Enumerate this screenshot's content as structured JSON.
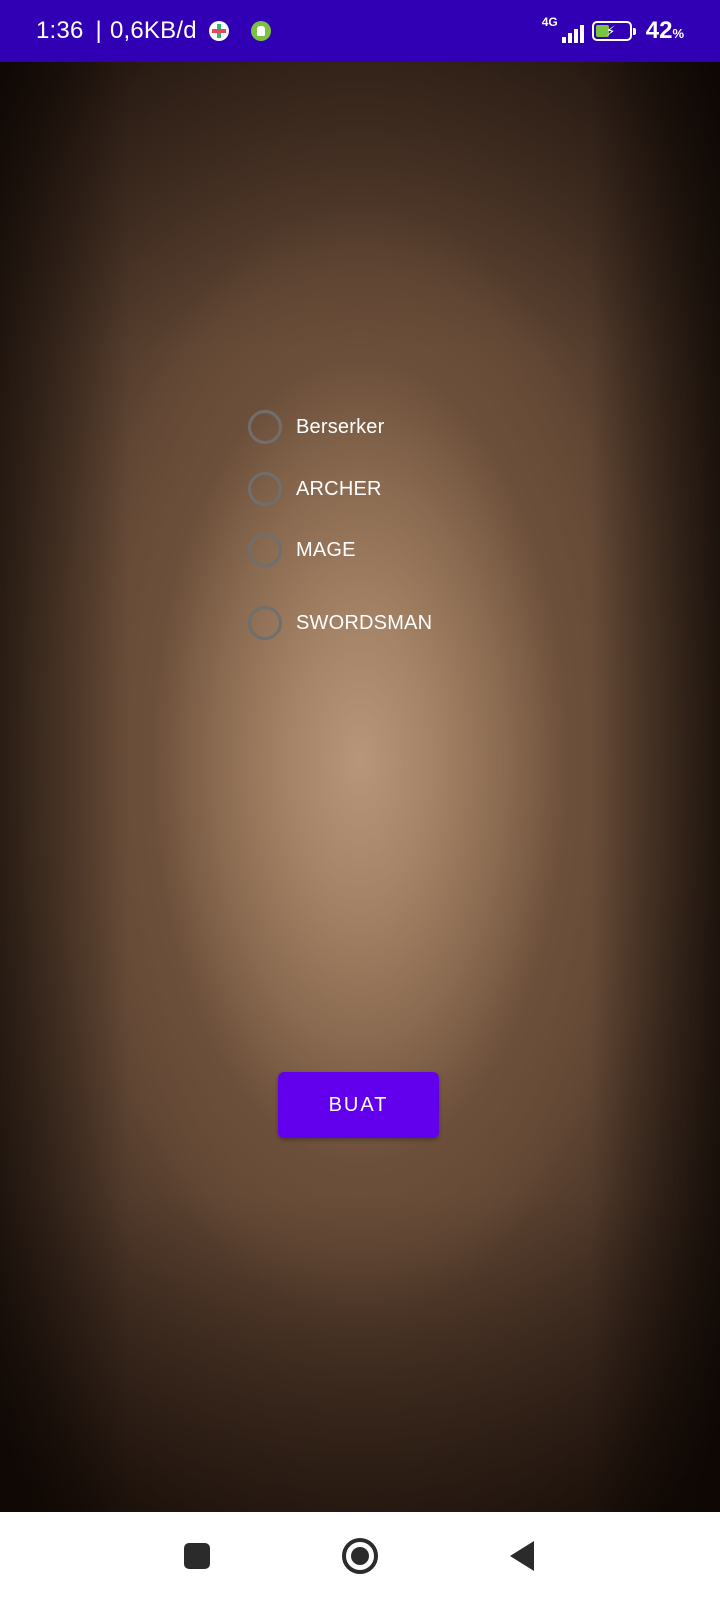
{
  "status_bar": {
    "time": "1:36",
    "separator": "|",
    "data_rate": "0,6KB/d",
    "notification_icons": [
      "app-plus-icon",
      "android-icon"
    ],
    "network_type": "4G",
    "signal_icon": "signal-icon",
    "battery_icon": "battery-charging-icon",
    "battery_percent": "42",
    "battery_percent_sign": "%",
    "battery_level": 0.42,
    "background_color": "#3200b4"
  },
  "main": {
    "radio_options": [
      {
        "label": "Berserker",
        "selected": false
      },
      {
        "label": "ARCHER",
        "selected": false
      },
      {
        "label": "MAGE",
        "selected": false
      },
      {
        "label": "SWORDSMAN",
        "selected": false
      }
    ],
    "create_button_label": "BUAT",
    "button_color": "#6200ee"
  },
  "nav_bar": {
    "recent_icon": "recent-apps-icon",
    "home_icon": "home-icon",
    "back_icon": "back-icon"
  }
}
